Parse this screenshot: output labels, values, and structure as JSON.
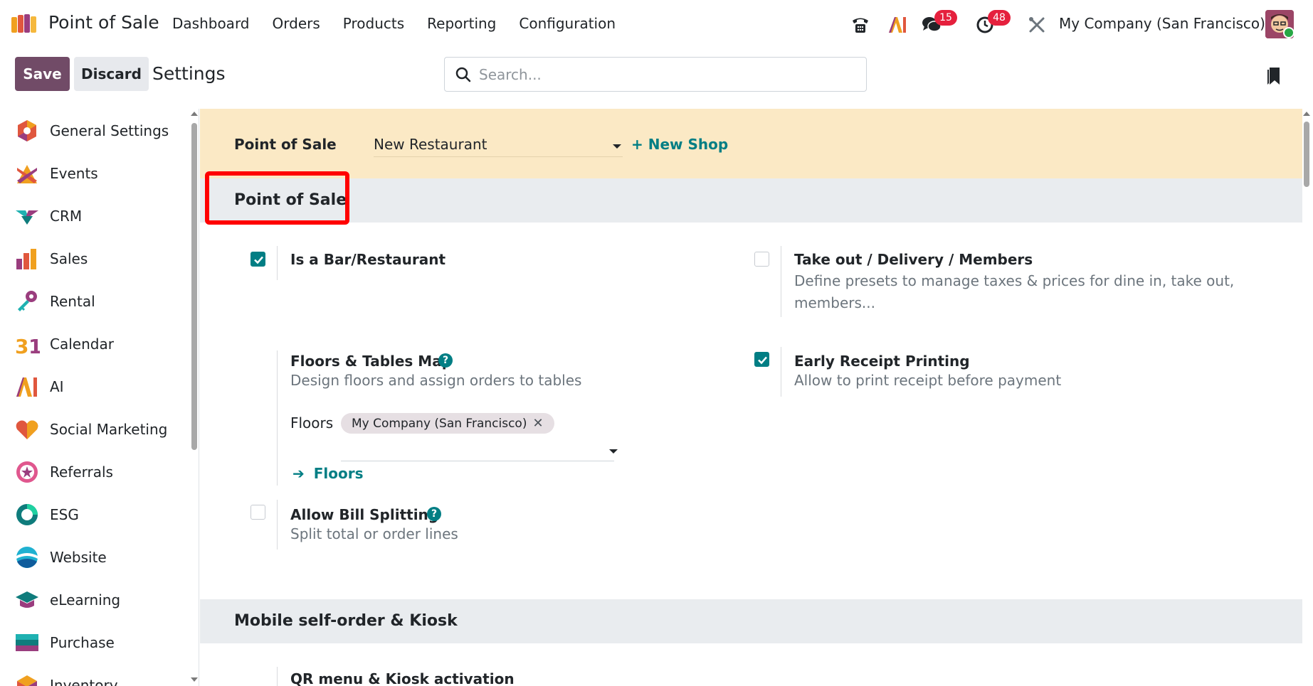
{
  "topnav": {
    "app_name": "Point of Sale",
    "menu": [
      "Dashboard",
      "Orders",
      "Products",
      "Reporting",
      "Configuration"
    ],
    "messages_count": "15",
    "activities_count": "48",
    "company": "My Company (San Francisco)",
    "ai_label": "AI"
  },
  "control_panel": {
    "save_label": "Save",
    "discard_label": "Discard",
    "title": "Settings",
    "search_placeholder": "Search..."
  },
  "sidebar": {
    "items": [
      {
        "label": "General Settings",
        "icon": "general-settings-icon"
      },
      {
        "label": "Events",
        "icon": "events-icon"
      },
      {
        "label": "CRM",
        "icon": "crm-icon"
      },
      {
        "label": "Sales",
        "icon": "sales-icon"
      },
      {
        "label": "Rental",
        "icon": "rental-icon"
      },
      {
        "label": "Calendar",
        "icon": "calendar-icon"
      },
      {
        "label": "AI",
        "icon": "ai-icon"
      },
      {
        "label": "Social Marketing",
        "icon": "social-marketing-icon"
      },
      {
        "label": "Referrals",
        "icon": "referrals-icon"
      },
      {
        "label": "ESG",
        "icon": "esg-icon"
      },
      {
        "label": "Website",
        "icon": "website-icon"
      },
      {
        "label": "eLearning",
        "icon": "elearning-icon"
      },
      {
        "label": "Purchase",
        "icon": "purchase-icon"
      },
      {
        "label": "Inventory",
        "icon": "inventory-icon"
      }
    ]
  },
  "shop_bar": {
    "label": "Point of Sale",
    "selected_shop": "New Restaurant",
    "new_shop_label": "+ New Shop"
  },
  "sections": {
    "pos_title": "Point of Sale",
    "mobile_title": "Mobile self-order & Kiosk"
  },
  "settings": {
    "bar_restaurant": {
      "title": "Is a Bar/Restaurant",
      "checked": true
    },
    "takeout": {
      "title": "Take out / Delivery / Members",
      "desc": "Define presets to manage taxes & prices for dine in, take out, members...",
      "checked": false
    },
    "floors_map": {
      "title": "Floors & Tables Map",
      "desc": "Design floors and assign orders to tables",
      "floors_label": "Floors",
      "floor_tag": "My Company (San Francisco)",
      "floors_link": "Floors"
    },
    "early_receipt": {
      "title": "Early Receipt Printing",
      "desc": "Allow to print receipt before payment",
      "checked": true
    },
    "bill_split": {
      "title": "Allow Bill Splitting",
      "desc": "Split total or order lines",
      "checked": false
    },
    "qr_menu": {
      "title": "QR menu & Kiosk activation"
    }
  },
  "colors": {
    "brand": "#714b67",
    "accent": "#017e84",
    "shop_bar_bg": "#fbe9c5",
    "section_bg": "#e9ecef",
    "badge": "#e5203d",
    "highlight": "#ff0000"
  }
}
